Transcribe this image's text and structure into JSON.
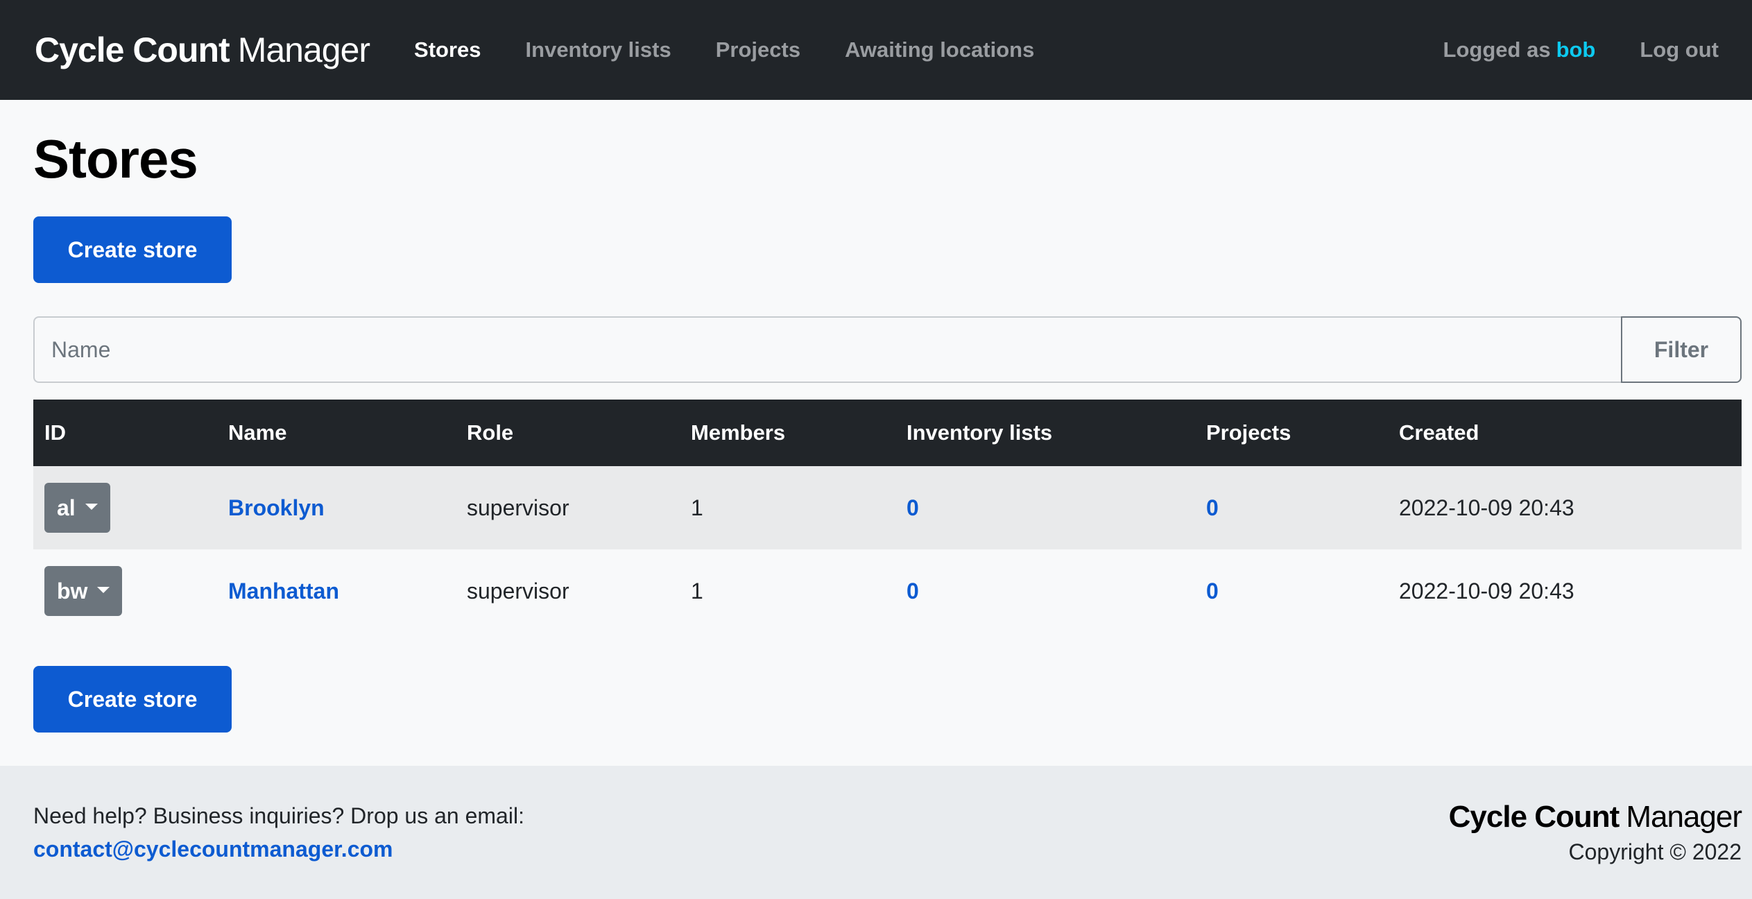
{
  "navbar": {
    "brand_bold": "Cycle Count",
    "brand_light": "Manager",
    "links": [
      "Stores",
      "Inventory lists",
      "Projects",
      "Awaiting locations"
    ],
    "logged_as_label": "Logged as",
    "username": "bob",
    "logout": "Log out"
  },
  "page": {
    "title": "Stores",
    "create_button": "Create store"
  },
  "filter": {
    "placeholder": "Name",
    "button": "Filter"
  },
  "table": {
    "headers": [
      "ID",
      "Name",
      "Role",
      "Members",
      "Inventory lists",
      "Projects",
      "Created"
    ],
    "rows": [
      {
        "id": "al",
        "name": "Brooklyn",
        "role": "supervisor",
        "members": "1",
        "inventory_lists": "0",
        "projects": "0",
        "created": "2022-10-09 20:43"
      },
      {
        "id": "bw",
        "name": "Manhattan",
        "role": "supervisor",
        "members": "1",
        "inventory_lists": "0",
        "projects": "0",
        "created": "2022-10-09 20:43"
      }
    ]
  },
  "footer": {
    "help_text": "Need help? Business inquiries? Drop us an email:",
    "email": "contact@cyclecountmanager.com",
    "brand_bold": "Cycle Count",
    "brand_light": "Manager",
    "copyright": "Copyright © 2022"
  },
  "colors": {
    "navbar_bg": "#212529",
    "primary": "#0d5bd1",
    "username": "#0dcaf0",
    "id_button": "#6c757d"
  }
}
